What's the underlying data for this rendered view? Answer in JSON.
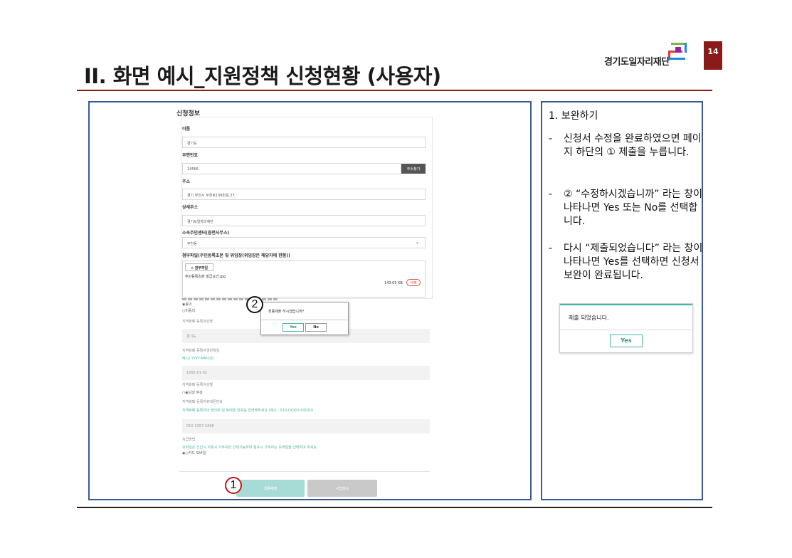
{
  "slide": {
    "title": "II. 화면 예시_지원정책 신청현황 (사용자)",
    "page_number": "14",
    "logo_text": "경기도일자리재단",
    "colors": {
      "accent": "#8b1a1a",
      "frame": "#3b5998",
      "teal": "#4ab3a8"
    }
  },
  "form": {
    "section_title": "신청정보",
    "name_label": "이름",
    "name_value": "경기도",
    "zip_label": "우편번호",
    "zip_value": "14566",
    "zip_button": "주소찾기",
    "address_label": "주소",
    "address_value": "경기 부천시 부천로136번길 27",
    "detail_label": "상세주소",
    "detail_value": "경기도일자리재단",
    "center_label": "소속주민센터(읍면사무소)",
    "center_value": "부천동",
    "attach_label": "첨부파일(주민등록초본 및 위임장(위임장은 해당자에 한함))",
    "attach_button": "+ 첨부파일",
    "attach_file": "주민등록초본 발급요건.jpg",
    "attach_size": "143.05 KB",
    "attach_delete": "삭제",
    "consent_yes": "동의",
    "consent_no": "미동의",
    "reg_name_label": "지역화폐 등록자성명",
    "reg_name_value": "경기도",
    "reg_birth_label": "지역화폐 등록자생년월일",
    "reg_birth_hint": "예시) YYYY-MM-DD",
    "reg_birth_value": "1955-01-02",
    "reg_gender_label": "지역화폐 등록자성별",
    "gender_options": "남성 여성",
    "reg_phone_label": "지역화폐 등록자휴대폰번호",
    "reg_phone_hint": "지역화폐 등록자의 명의로 된 휴대폰 번호를 입력해주세요.(예시 : 010-OOOO-OOOO)",
    "reg_phone_value": "010-1357-2468",
    "pay_label": "지급방법",
    "pay_hint": "모바일은 선납시 사용시 가주자만 선택가능하며 점포시 가주자는 모바일을 선택하여 주세요.",
    "pay_options": "카드 모바일",
    "submit_button": "최종제출",
    "bizinfo_button": "사업정보"
  },
  "confirm_dialog": {
    "message": "최종제출 하시겠습니까?",
    "yes": "Yes",
    "no": "No"
  },
  "markers": {
    "one": "1",
    "two": "2"
  },
  "instructions": {
    "heading": "1.  보완하기",
    "items": [
      "신청서 수정을 완료하였으면 페이지 하단의 ① 제출을 누릅니다.",
      "② “수정하시겠습니까” 라는 창이 나타나면 Yes 또는 No를 선택합니다.",
      "다시 “제출되었습니다” 라는 창이 나타나면 Yes를 선택하면 신청서 보완이 완료됩니다."
    ],
    "dash": "-"
  },
  "done_dialog": {
    "message": "제출 되었습니다.",
    "yes": "Yes"
  }
}
